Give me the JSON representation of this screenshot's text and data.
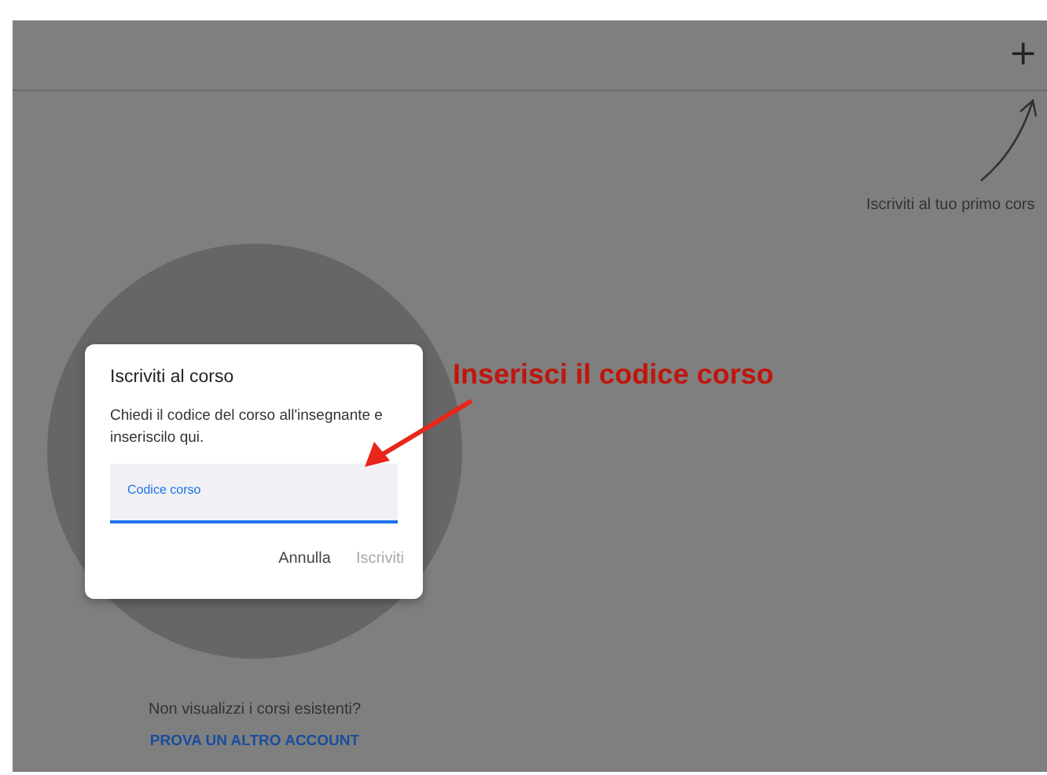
{
  "header": {
    "add_button": "+"
  },
  "hint": {
    "text": "Iscriviti al tuo primo cors"
  },
  "dialog": {
    "title": "Iscriviti al corso",
    "body": "Chiedi il codice del corso all'insegnante e inseriscilo qui.",
    "field": {
      "label": "Codice corso",
      "focused": true
    },
    "buttons": [
      {
        "label": "Annulla",
        "disabled": false
      },
      {
        "label": "Iscriviti",
        "disabled": true
      }
    ]
  },
  "annotation": {
    "text": "Inserisci il codice corso"
  },
  "footer": {
    "question": "Non visualizzi i corsi esistenti?",
    "link": "PROVA UN ALTRO ACCOUNT"
  }
}
